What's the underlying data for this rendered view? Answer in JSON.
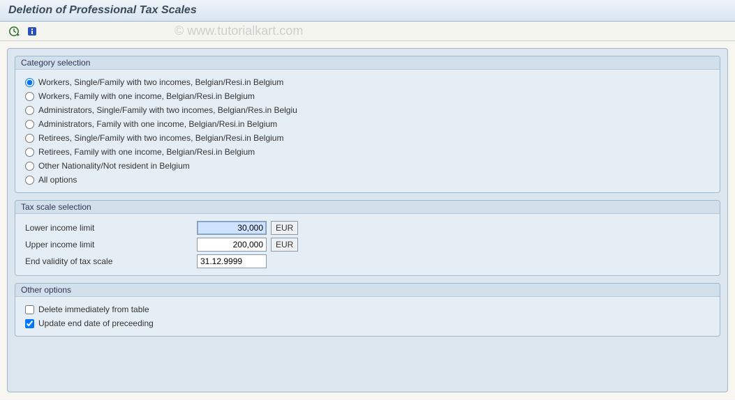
{
  "title": "Deletion of Professional Tax Scales",
  "watermark": "© www.tutorialkart.com",
  "groups": {
    "category": {
      "legend": "Category selection",
      "options": [
        "Workers, Single/Family with two incomes, Belgian/Resi.in Belgium",
        "Workers, Family with one income, Belgian/Resi.in Belgium",
        "Administrators, Single/Family with two incomes, Belgian/Res.in Belgiu",
        "Administrators, Family with one income, Belgian/Resi.in Belgium",
        "Retirees, Single/Family with two incomes, Belgian/Resi.in Belgium",
        "Retirees, Family with one income, Belgian/Resi.in Belgium",
        "Other Nationality/Not resident in Belgium",
        "All options"
      ],
      "selected_index": 0
    },
    "tax_scale": {
      "legend": "Tax scale selection",
      "lower_label": "Lower income limit",
      "lower_value": "30,000",
      "lower_unit": "EUR",
      "upper_label": "Upper income limit",
      "upper_value": "200,000",
      "upper_unit": "EUR",
      "end_label": "End validity of tax scale",
      "end_value": "31.12.9999"
    },
    "other": {
      "legend": "Other options",
      "delete_label": "Delete immediately from table",
      "delete_checked": false,
      "update_label": "Update end date of preceeding",
      "update_checked": true
    }
  }
}
